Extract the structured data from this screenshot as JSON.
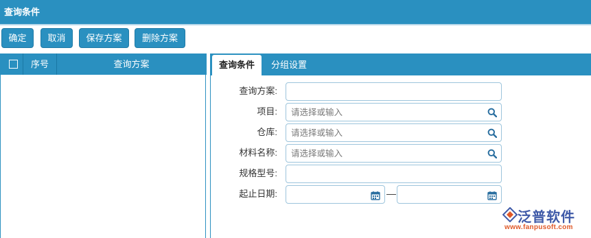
{
  "window": {
    "title": "查询条件"
  },
  "toolbar": {
    "confirm_label": "确定",
    "cancel_label": "取消",
    "save_scheme_label": "保存方案",
    "delete_scheme_label": "删除方案"
  },
  "scheme_list": {
    "columns": {
      "index": "序号",
      "scheme": "查询方案"
    }
  },
  "tabs": [
    {
      "label": "查询条件",
      "active": true
    },
    {
      "label": "分组设置",
      "active": false
    }
  ],
  "form": {
    "scheme": {
      "label": "查询方案:",
      "value": ""
    },
    "project": {
      "label": "项目:",
      "placeholder": "请选择或输入",
      "icon": "search-icon"
    },
    "warehouse": {
      "label": "仓库:",
      "placeholder": "请选择或输入",
      "icon": "search-icon"
    },
    "material_name": {
      "label": "材料名称:",
      "placeholder": "请选择或输入",
      "icon": "search-icon"
    },
    "spec_model": {
      "label": "规格型号:",
      "value": ""
    },
    "date_range": {
      "label": "起止日期:",
      "separator": "—",
      "start": "",
      "end": "",
      "icon": "calendar-icon"
    }
  },
  "branding": {
    "logo_text": "泛普软件",
    "logo_url": "www.fanpusoft.com"
  },
  "colors": {
    "accent": "#2a90c0",
    "field_border": "#9cc4dc",
    "brand": "#3f5aa8"
  }
}
